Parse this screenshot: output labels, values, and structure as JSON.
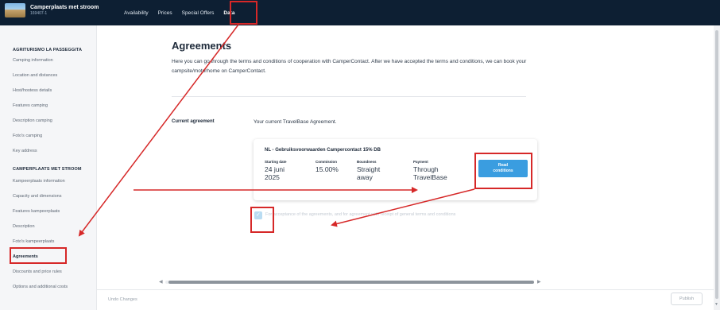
{
  "brand": {
    "name": "Camperplaats met stroom",
    "id": "169407-1"
  },
  "nav": [
    {
      "label": "Availability"
    },
    {
      "label": "Prices"
    },
    {
      "label": "Special Offers"
    },
    {
      "label": "Data",
      "active": true
    }
  ],
  "sidebar": {
    "section1_title": "AGRITURISMO LA PASSEGGITA",
    "section1_items": [
      {
        "label": "Camping information"
      },
      {
        "label": "Location and distances"
      },
      {
        "label": "Host/hostess details"
      },
      {
        "label": "Features camping"
      },
      {
        "label": "Description camping"
      },
      {
        "label": "Foto's camping"
      },
      {
        "label": "Key address"
      }
    ],
    "section2_title": "CAMPERPLAATS MET STROOM",
    "section2_items": [
      {
        "label": "Kampeerplaats information"
      },
      {
        "label": "Capacity and dimensions"
      },
      {
        "label": "Features kampeerplaats"
      },
      {
        "label": "Description"
      },
      {
        "label": "Foto's kampeerplaats"
      },
      {
        "label": "Agreements",
        "active": true
      },
      {
        "label": "Discounts and price rules"
      },
      {
        "label": "Options and additional costs"
      }
    ]
  },
  "main": {
    "title": "Agreements",
    "intro": "Here you can go through the terms and conditions of cooperation with CamperContact. After we have accepted the terms and conditions, we can book your campsite/motorhome on CamperContact.",
    "current_label": "Current agreement",
    "current_value": "Your current TravelBase Agreement.",
    "card": {
      "title": "NL - Gebruiksvoorwaarden Campercontact 15% DB",
      "columns": [
        {
          "header": "Starting date",
          "value_line1": "24 juni",
          "value_line2": "2025"
        },
        {
          "header": "Commission",
          "value_line1": "15.00%",
          "value_line2": ""
        },
        {
          "header": "Boundness",
          "value_line1": "Straight",
          "value_line2": "away"
        },
        {
          "header": "Payment",
          "value_line1": "Through",
          "value_line2": "TravelBase"
        }
      ],
      "button_line1": "Read",
      "button_line2": "conditions"
    },
    "accept_text": "For acceptance of the agreements, and for agreement with receipt of general terms and conditions"
  },
  "footer": {
    "undo": "Undo Changes",
    "publish": "Publish"
  },
  "colors": {
    "topbar": "#0d1f33",
    "accent": "#3a9de0",
    "annotation": "#d62828"
  },
  "icons": {
    "check": "check-icon",
    "scroll_left": "arrow-left-icon",
    "scroll_right": "arrow-right-icon"
  }
}
